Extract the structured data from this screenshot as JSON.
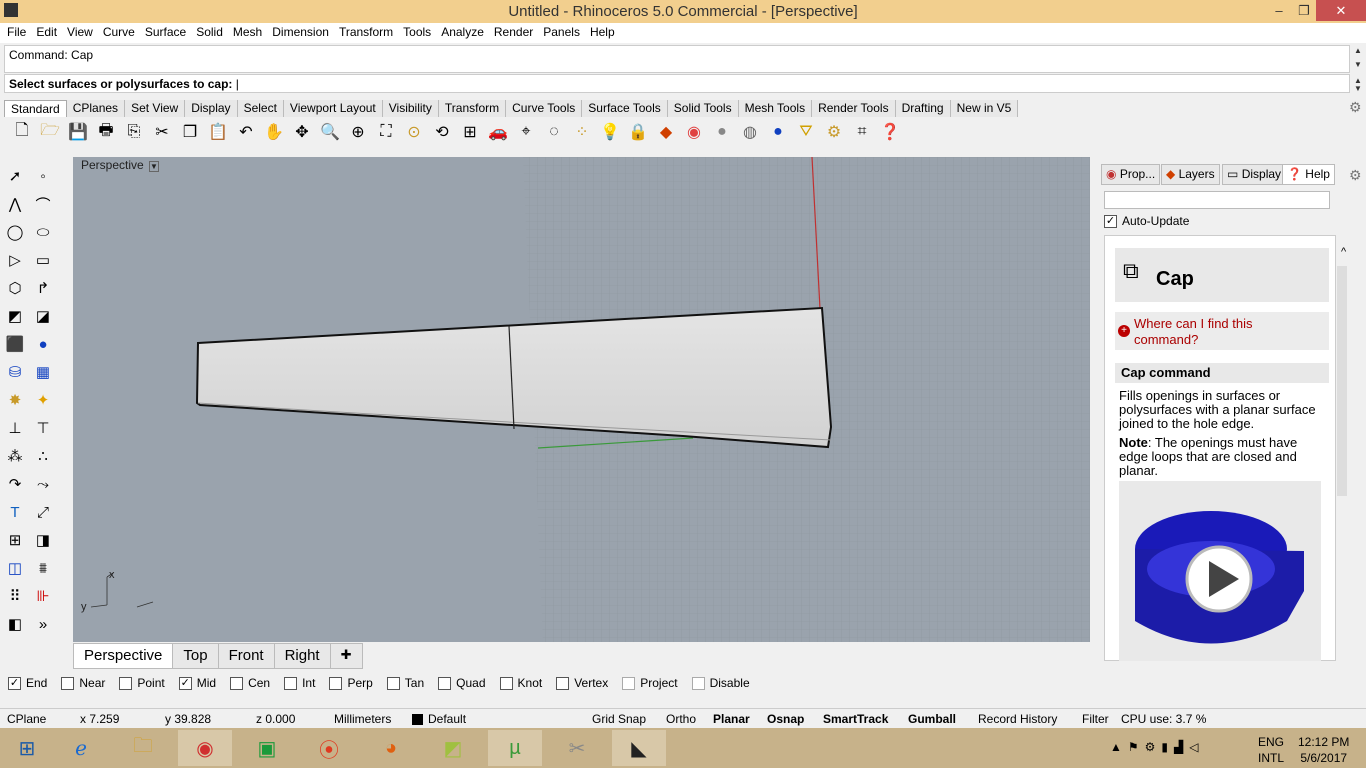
{
  "window": {
    "title": "Untitled - Rhinoceros 5.0 Commercial - [Perspective]",
    "min": "–",
    "max": "❐",
    "close": "✕"
  },
  "menu": [
    "File",
    "Edit",
    "View",
    "Curve",
    "Surface",
    "Solid",
    "Mesh",
    "Dimension",
    "Transform",
    "Tools",
    "Analyze",
    "Render",
    "Panels",
    "Help"
  ],
  "command": {
    "history": "Command: Cap",
    "prompt": "Select surfaces or polysurfaces to cap:"
  },
  "toolbar_tabs": [
    "Standard",
    "CPlanes",
    "Set View",
    "Display",
    "Select",
    "Viewport Layout",
    "Visibility",
    "Transform",
    "Curve Tools",
    "Surface Tools",
    "Solid Tools",
    "Mesh Tools",
    "Render Tools",
    "Drafting",
    "New in V5"
  ],
  "toolbar_icons": [
    "new-icon",
    "open-icon",
    "save-icon",
    "print-icon",
    "import-icon",
    "cut-icon",
    "copy-icon",
    "paste-icon",
    "undo-icon",
    "pan-icon",
    "rotate-view-icon",
    "zoom-icon",
    "zoom-window-icon",
    "zoom-extents-icon",
    "zoom-selected-icon",
    "rotate-icon",
    "four-views-icon",
    "car-icon",
    "set-cplane-icon",
    "cplane-icon",
    "point-icon",
    "light-icon",
    "lock-icon",
    "layer-icon",
    "color-wheel-icon",
    "sphere-gray-icon",
    "sphere-shaded-icon",
    "sphere-blue-icon",
    "filter-icon",
    "gear-icon",
    "snap-icon",
    "help-icon"
  ],
  "viewport": {
    "label": "Perspective",
    "axis_x": "x",
    "axis_y": "y"
  },
  "viewport_tabs": [
    "Perspective",
    "Top",
    "Front",
    "Right"
  ],
  "panel": {
    "tabs": [
      "Prop...",
      "Layers",
      "Display",
      "Help"
    ],
    "auto_update": "Auto-Update",
    "cmd_title": "Cap",
    "where": "Where can I find this command?",
    "section": "Cap command",
    "desc": "Fills openings in surfaces or polysurfaces with a planar surface joined to the hole edge.",
    "note_label": "Note",
    "note": ": The openings must have edge loops that are closed and planar."
  },
  "osnaps": [
    {
      "label": "End",
      "checked": true
    },
    {
      "label": "Near",
      "checked": false
    },
    {
      "label": "Point",
      "checked": false
    },
    {
      "label": "Mid",
      "checked": true
    },
    {
      "label": "Cen",
      "checked": false
    },
    {
      "label": "Int",
      "checked": false
    },
    {
      "label": "Perp",
      "checked": false
    },
    {
      "label": "Tan",
      "checked": false
    },
    {
      "label": "Quad",
      "checked": false
    },
    {
      "label": "Knot",
      "checked": false
    },
    {
      "label": "Vertex",
      "checked": false
    },
    {
      "label": "Project",
      "checked": false
    },
    {
      "label": "Disable",
      "checked": false
    }
  ],
  "status": {
    "cplane": "CPlane",
    "x": "x 7.259",
    "y": "y 39.828",
    "z": "z 0.000",
    "units": "Millimeters",
    "layer": "Default",
    "grid_snap": "Grid Snap",
    "ortho": "Ortho",
    "planar": "Planar",
    "osnap": "Osnap",
    "smarttrack": "SmartTrack",
    "gumball": "Gumball",
    "record": "Record History",
    "filter": "Filter",
    "cpu": "CPU use: 3.7 %"
  },
  "taskbar": {
    "lang1": "ENG",
    "lang2": "INTL",
    "time": "12:12 PM",
    "date": "5/6/2017"
  }
}
